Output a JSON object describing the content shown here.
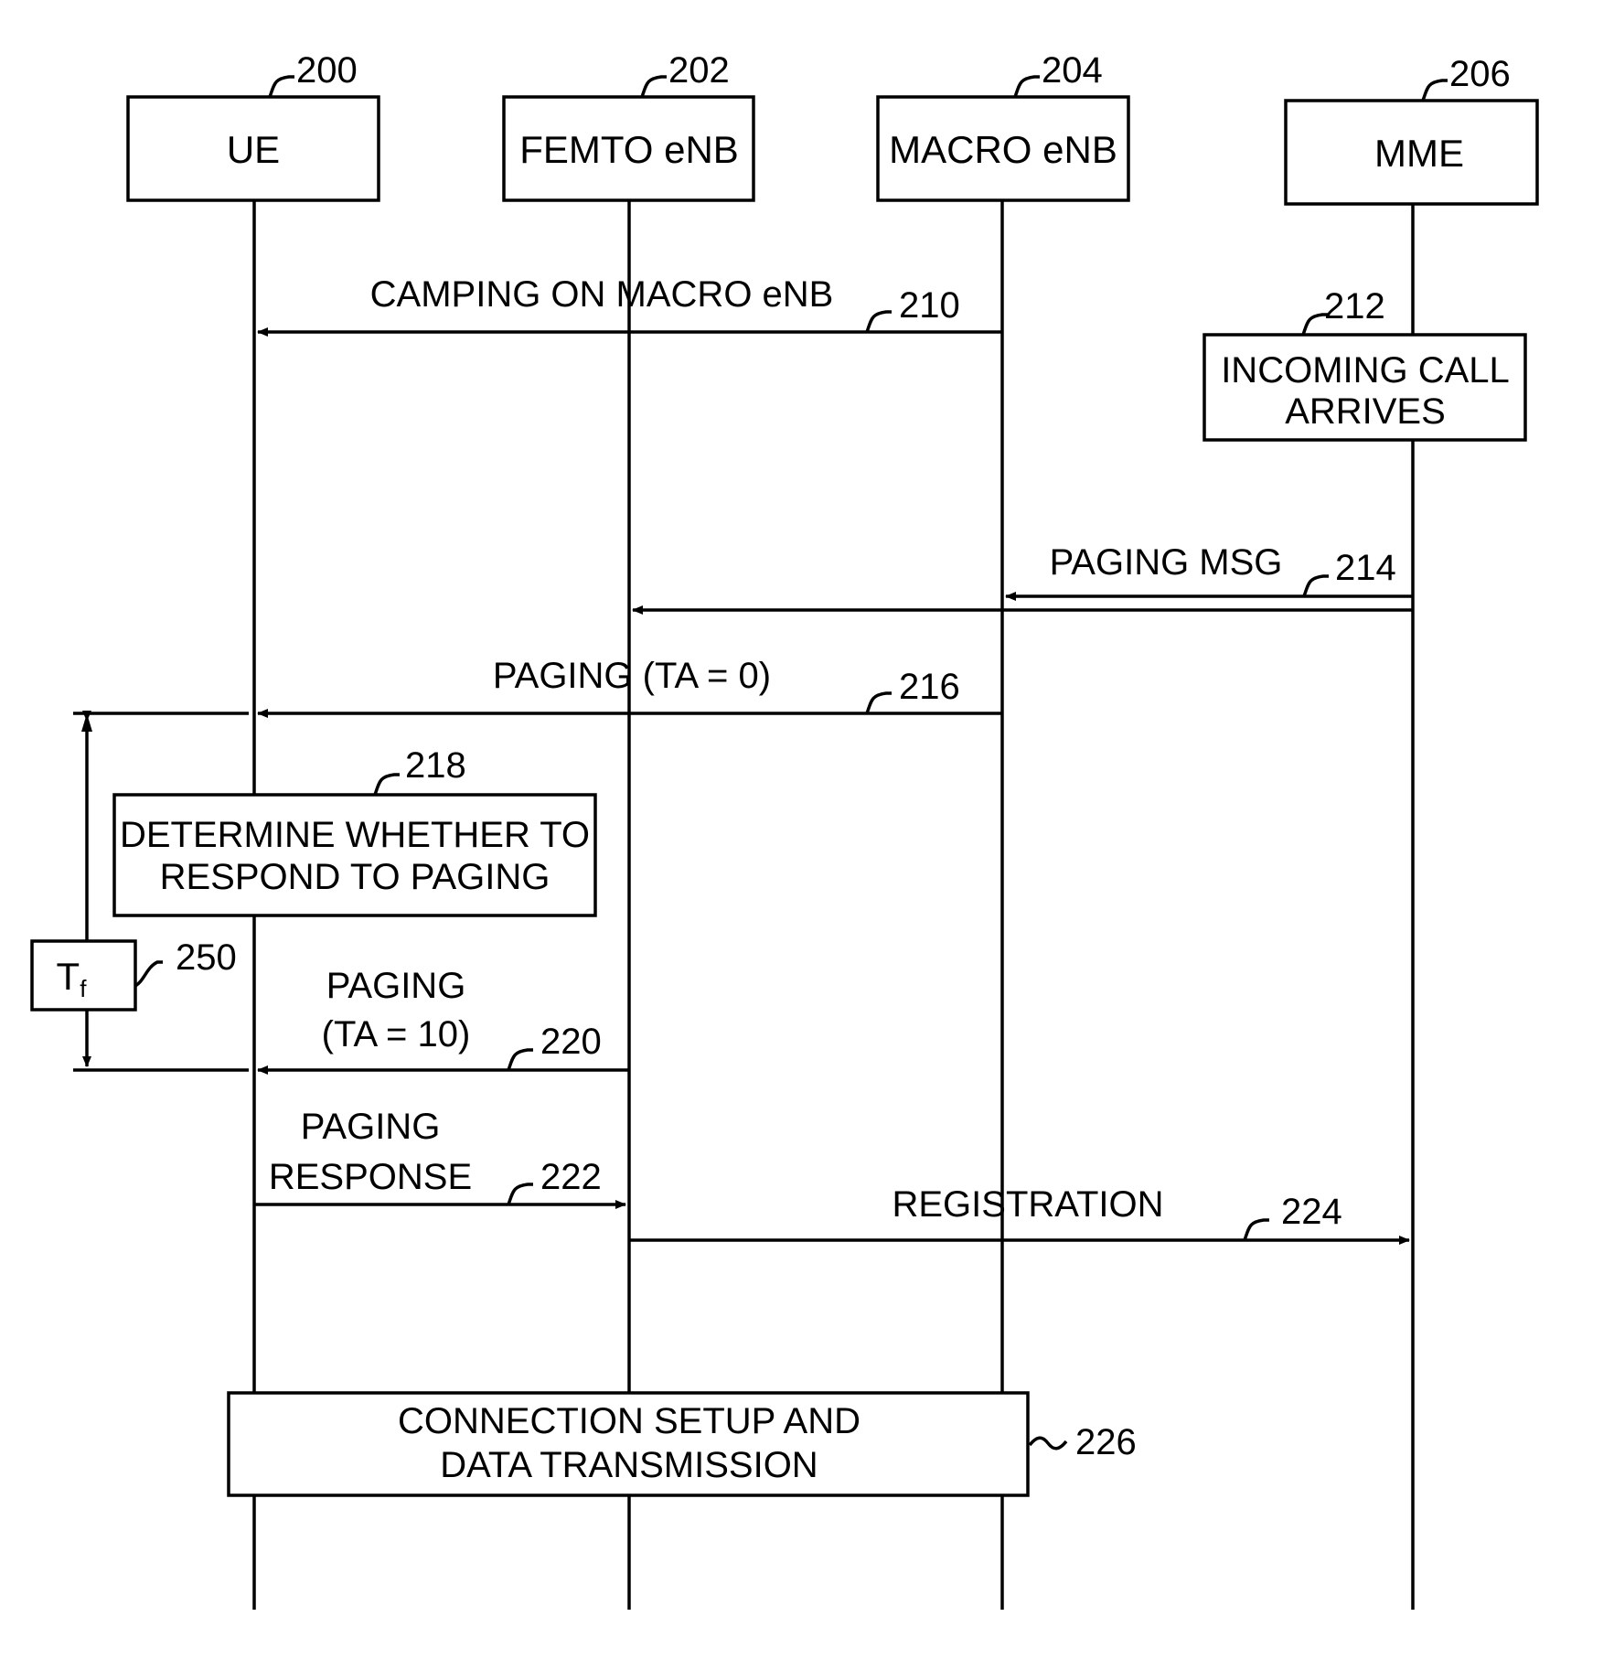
{
  "diagram": {
    "type": "sequence",
    "participants": [
      {
        "id": "ue",
        "label": "UE",
        "ref": "200"
      },
      {
        "id": "femto",
        "label": "FEMTO eNB",
        "ref": "202"
      },
      {
        "id": "macro",
        "label": "MACRO eNB",
        "ref": "204"
      },
      {
        "id": "mme",
        "label": "MME",
        "ref": "206"
      }
    ],
    "steps": [
      {
        "ref": "210",
        "kind": "message",
        "from": "macro",
        "to": "ue",
        "lines": [
          "CAMPING ON MACRO eNB"
        ]
      },
      {
        "ref": "212",
        "kind": "note",
        "on": "mme",
        "lines": [
          "INCOMING CALL",
          "ARRIVES"
        ]
      },
      {
        "ref": "214",
        "kind": "message",
        "from": "mme",
        "to": "femto",
        "via": "macro",
        "lines": [
          "PAGING MSG"
        ]
      },
      {
        "ref": "216",
        "kind": "message",
        "from": "macro",
        "to": "ue",
        "lines": [
          "PAGING (TA = 0)"
        ]
      },
      {
        "ref": "218",
        "kind": "note",
        "on": "ue",
        "lines": [
          "DETERMINE WHETHER TO",
          "RESPOND TO PAGING"
        ]
      },
      {
        "ref": "220",
        "kind": "message",
        "from": "femto",
        "to": "ue",
        "lines": [
          "PAGING",
          "(TA = 10)"
        ]
      },
      {
        "ref": "222",
        "kind": "message",
        "from": "ue",
        "to": "femto",
        "lines": [
          "PAGING",
          "RESPONSE"
        ]
      },
      {
        "ref": "224",
        "kind": "message",
        "from": "femto",
        "to": "mme",
        "lines": [
          "REGISTRATION"
        ]
      },
      {
        "ref": "226",
        "kind": "note",
        "on": "ue-macro",
        "lines": [
          "CONNECTION SETUP AND",
          "DATA TRANSMISSION"
        ]
      }
    ],
    "timer": {
      "ref": "250",
      "label": "T",
      "subscript": "f",
      "spans": [
        "216",
        "220"
      ]
    }
  }
}
